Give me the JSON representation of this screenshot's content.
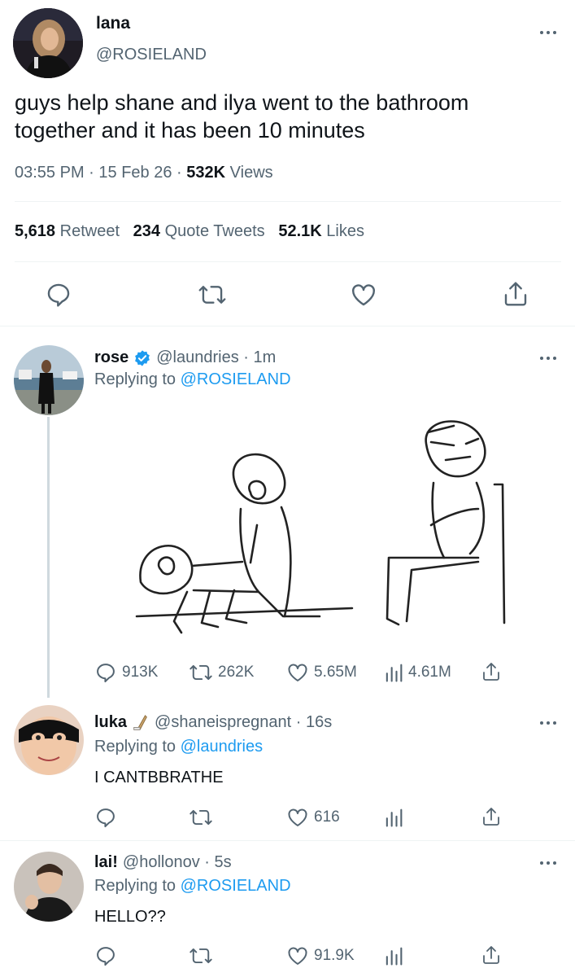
{
  "main_tweet": {
    "display_name": "lana",
    "handle": "@ROSIELAND",
    "text_line1": "guys help shane and ilya went to the bathroom",
    "text_line2": "together and it has been 10 minutes",
    "time": "03:55 PM",
    "date": "15 Feb 26",
    "separator": "·",
    "views_count": "532K",
    "views_label": "Views",
    "retweets_count": "5,618",
    "retweets_label": "Retweet",
    "quotes_count": "234",
    "quotes_label": "Quote Tweets",
    "likes_count": "52.1K",
    "likes_label": "Likes"
  },
  "replies": [
    {
      "display_name": "rose",
      "verified": true,
      "handle_time": "@laundries · 1m",
      "replying_prefix": "Replying to",
      "replying_to": "@ROSIELAND",
      "text": "",
      "has_image": true,
      "reply_count": "913K",
      "retweet_count": "262K",
      "like_count": "5.65M",
      "view_count": "4.61M"
    },
    {
      "display_name": "luka",
      "emoji": "🏒",
      "handle_time": "@shaneispregnant · 16s",
      "replying_prefix": "Replying to",
      "replying_to": "@laundries",
      "text": "I CANTBBRATHE",
      "reply_count": "",
      "retweet_count": "",
      "like_count": "616",
      "view_count": ""
    },
    {
      "display_name": "lai!",
      "handle_time": "@hollonov · 5s",
      "replying_prefix": "Replying to",
      "replying_to": "@ROSIELAND",
      "text": "HELLO??",
      "reply_count": "",
      "retweet_count": "",
      "like_count": "91.9K",
      "view_count": ""
    }
  ],
  "colors": {
    "accent": "#1d9bf0",
    "secondary_text": "#536471",
    "divider": "#eff3f4",
    "thread_line": "#cfd9de"
  },
  "icons": [
    "more-icon",
    "reply-icon",
    "retweet-icon",
    "like-icon",
    "share-icon",
    "views-icon",
    "verified-badge-icon",
    "hockey-stick-icon"
  ]
}
